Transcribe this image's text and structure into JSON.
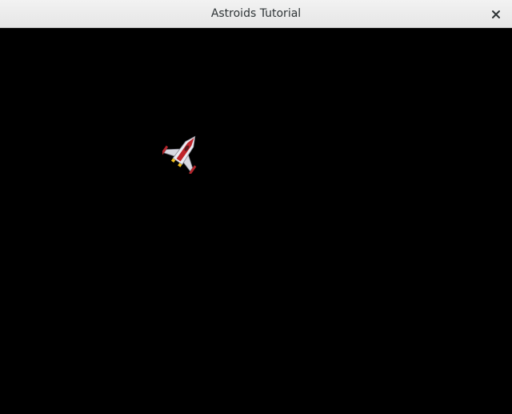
{
  "window": {
    "title": "Astroids Tutorial",
    "close_icon": "close-icon"
  },
  "game": {
    "background_color": "#000000",
    "ship_icon": "spaceship-icon",
    "ship_colors": {
      "body": "#e8e8ee",
      "stripe": "#c0242a",
      "wing_tips": "#b3262c",
      "engines": "#f2c01e"
    }
  }
}
